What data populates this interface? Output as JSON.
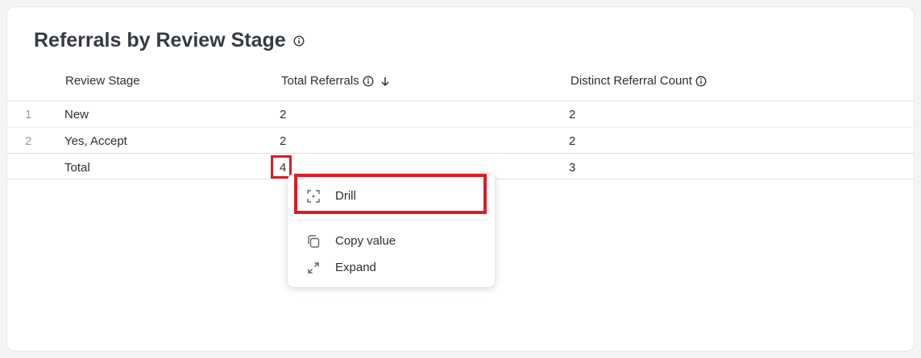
{
  "card": {
    "title": "Referrals by Review Stage",
    "title_icon": "info-icon"
  },
  "table": {
    "columns": [
      {
        "label": "Review Stage"
      },
      {
        "label": "Total Referrals",
        "icons": [
          "info-icon",
          "sort-descending-icon"
        ]
      },
      {
        "label": "Distinct Referral Count",
        "icons": [
          "info-icon"
        ]
      }
    ],
    "rows": [
      {
        "index": "1",
        "stage": "New",
        "total": "2",
        "distinct": "2"
      },
      {
        "index": "2",
        "stage": "Yes, Accept",
        "total": "2",
        "distinct": "2"
      }
    ],
    "total_row": {
      "label": "Total",
      "total": "4",
      "distinct": "3"
    }
  },
  "context_menu": {
    "items": [
      {
        "label": "Drill",
        "icon": "drill-focus-icon"
      },
      {
        "label": "Copy value",
        "icon": "copy-icon"
      },
      {
        "label": "Expand",
        "icon": "expand-icon"
      }
    ]
  },
  "colors": {
    "highlight": "#e01b24",
    "text": "#2b2f36",
    "muted": "#9aa0a8"
  }
}
